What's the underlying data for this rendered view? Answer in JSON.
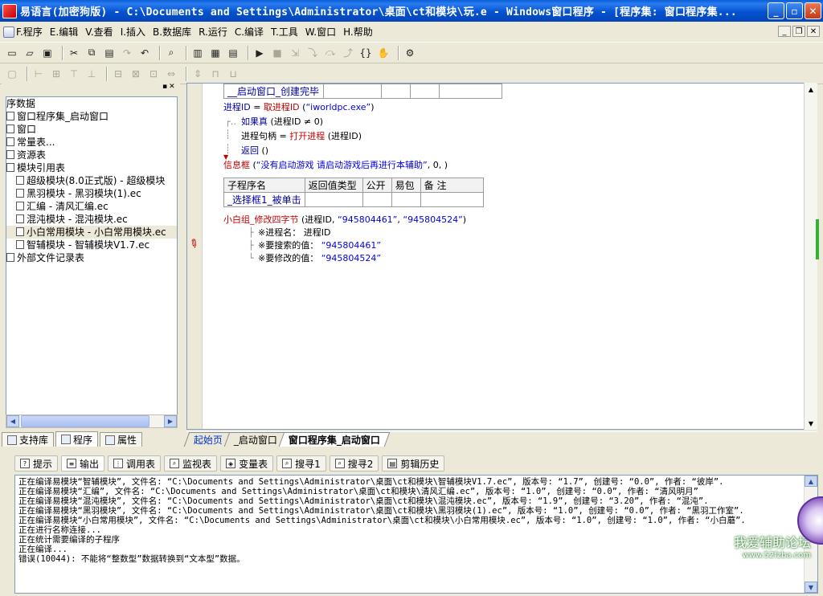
{
  "window": {
    "title": "易语言(加密狗版) - C:\\Documents and Settings\\Administrator\\桌面\\ct和模块\\玩.e - Windows窗口程序 - [程序集: 窗口程序集..."
  },
  "menu": [
    {
      "label": "F.程序"
    },
    {
      "label": "E.编辑"
    },
    {
      "label": "V.查看"
    },
    {
      "label": "I.插入"
    },
    {
      "label": "B.数据库"
    },
    {
      "label": "R.运行"
    },
    {
      "label": "C.编译"
    },
    {
      "label": "T.工具"
    },
    {
      "label": "W.窗口"
    },
    {
      "label": "H.帮助"
    }
  ],
  "tree": [
    {
      "label": "序数据"
    },
    {
      "label": "窗口程序集_启动窗口"
    },
    {
      "label": "窗口"
    },
    {
      "label": "常量表..."
    },
    {
      "label": "资源表"
    },
    {
      "label": "模块引用表"
    },
    {
      "label": "超级模块(8.0正式版) - 超级模块"
    },
    {
      "label": "黑羽模块 - 黑羽模块(1).ec"
    },
    {
      "label": "汇编 - 清风汇编.ec"
    },
    {
      "label": "混沌模块 - 混沌模块.ec"
    },
    {
      "label": "小白常用模块 - 小白常用模块.ec"
    },
    {
      "label": "智辅模块 - 智辅模块V1.7.ec"
    },
    {
      "label": "外部文件记录表"
    }
  ],
  "left_tabs": [
    {
      "label": "支持库"
    },
    {
      "label": "程序"
    },
    {
      "label": "属性"
    }
  ],
  "code": {
    "sub_name_top": "__启动窗口_创建完毕",
    "line1_a": "进程ID",
    "line1_b": " = ",
    "line1_c": "取进程ID",
    "line1_d": " (",
    "line1_e": "“iworldpc.exe”",
    "line1_f": ")",
    "if_kw": "如果真",
    "if_cond": " (进程ID ≠ 0)",
    "line3_a": "进程句柄",
    "line3_b": " = ",
    "line3_c": "打开进程",
    "line3_d": " (进程ID)",
    "return_kw": "返回",
    "return_args": " ()",
    "msg_fn": "信息框",
    "msg_args_a": " (",
    "msg_str": "“没有启动游戏 请启动游戏后再进行本辅助”",
    "msg_args_b": ", 0, )",
    "table_headers": [
      "子程序名",
      "返回值类型",
      "公开",
      "易包",
      "备 注"
    ],
    "table_row": [
      "_选择框1_被单击",
      "",
      "",
      "",
      ""
    ],
    "call_fn": "小白组_修改四字节",
    "call_args_a": " (进程ID, ",
    "call_str1": "“945804461”",
    "call_sep": ", ",
    "call_str2": "“945804524”",
    "call_args_b": ")",
    "param1_label": "※进程名：",
    "param1_value": "进程ID",
    "param2_label": "※要搜索的值：",
    "param2_value": "“945804461”",
    "param3_label": "※要修改的值：",
    "param3_value": "“945804524”"
  },
  "editor_tabs": [
    {
      "label": "起始页"
    },
    {
      "label": "_启动窗口"
    },
    {
      "label": "窗口程序集_启动窗口"
    }
  ],
  "bottom_tabs": [
    {
      "label": "提示"
    },
    {
      "label": "输出"
    },
    {
      "label": "调用表"
    },
    {
      "label": "监视表"
    },
    {
      "label": "变量表"
    },
    {
      "label": "搜寻1"
    },
    {
      "label": "搜寻2"
    },
    {
      "label": "剪辑历史"
    }
  ],
  "output_lines": [
    "正在编译易模块“智辅模块”, 文件名: “C:\\Documents and Settings\\Administrator\\桌面\\ct和模块\\智辅模块V1.7.ec”, 版本号: “1.7”, 创建号: “0.0”, 作者: “彼岸”.",
    "正在编译易模块“汇编”, 文件名: “C:\\Documents and Settings\\Administrator\\桌面\\ct和模块\\清风汇编.ec”, 版本号: “1.0”, 创建号: “0.0”, 作者: “清风明月”",
    "正在编译易模块“混沌模块”, 文件名: “C:\\Documents and Settings\\Administrator\\桌面\\ct和模块\\混沌模块.ec”, 版本号: “1.9”, 创建号: “3.20”, 作者: “混沌”.",
    "正在编译易模块“黑羽模块”, 文件名: “C:\\Documents and Settings\\Administrator\\桌面\\ct和模块\\黑羽模块(1).ec”, 版本号: “1.0”, 创建号: “0.0”, 作者: “黑羽工作室”.",
    "正在编译易模块“小白常用模块”, 文件名: “C:\\Documents and Settings\\Administrator\\桌面\\ct和模块\\小白常用模块.ec”, 版本号: “1.0”, 创建号: “1.0”, 作者: “小白蘑”.",
    "正在进行名称连接...",
    "正在统计需要编译的子程序",
    "正在编译...",
    "错误(10044): 不能将“整数型”数据转换到“文本型”数据。"
  ],
  "watermark": {
    "line1": "我爱辅助论坛",
    "line2": "www.52fzba.com"
  }
}
